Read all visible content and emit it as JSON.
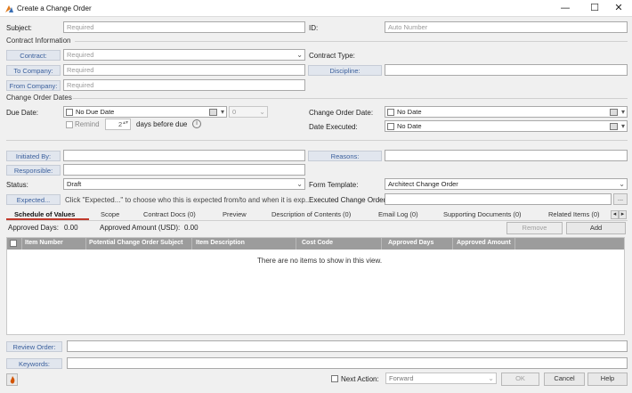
{
  "window": {
    "title": "Create a Change Order",
    "minimize": "—",
    "maximize": "☐",
    "close": "✕"
  },
  "form": {
    "subject_label": "Subject:",
    "subject_placeholder": "Required",
    "id_label": "ID:",
    "id_placeholder": "Auto Number",
    "contract_info_section": "Contract Information",
    "contract_btn": "Contract:",
    "contract_placeholder": "Required",
    "contract_type_label": "Contract Type:",
    "to_company_btn": "To Company:",
    "to_company_placeholder": "Required",
    "discipline_btn": "Discipline:",
    "from_company_btn": "From Company:",
    "from_company_placeholder": "Required",
    "dates_section": "Change Order Dates",
    "due_date_label": "Due Date:",
    "due_date_value": "No Due Date",
    "time_value": "0",
    "remind_label": "Remind",
    "remind_days": "2",
    "days_before_due": "days before due",
    "info_icon": "i",
    "co_date_label": "Change Order Date:",
    "co_date_value": "No Date",
    "executed_label": "Date Executed:",
    "executed_value": "No Date",
    "initiated_by_btn": "Initiated By:",
    "reasons_btn": "Reasons:",
    "responsible_btn": "Responsible:",
    "status_label": "Status:",
    "status_value": "Draft",
    "form_template_label": "Form Template:",
    "form_template_value": "Architect Change Order",
    "expected_btn": "Expected...",
    "expected_hint": "Click \"Expected...\" to choose who this is expected from/to and when it is exp...",
    "executed_co_label": "Executed Change Order:",
    "executed_co_browse": "...",
    "review_order_btn": "Review Order:",
    "keywords_btn": "Keywords:"
  },
  "tabs": [
    {
      "label": "Schedule of Values",
      "active": true
    },
    {
      "label": "Scope"
    },
    {
      "label": "Contract Docs (0)"
    },
    {
      "label": "Preview"
    },
    {
      "label": "Description of Contents (0)"
    },
    {
      "label": "Email Log (0)"
    },
    {
      "label": "Supporting Documents (0)"
    },
    {
      "label": "Related Items (0)"
    }
  ],
  "tab_scroll": {
    "left": "◂",
    "right": "▸"
  },
  "sov": {
    "approved_days_label": "Approved Days:",
    "approved_days_value": "0.00",
    "approved_amount_label": "Approved Amount (USD):",
    "approved_amount_value": "0.00",
    "remove_btn": "Remove",
    "add_btn": "Add",
    "columns": [
      "Item Number",
      "Potential Change Order Subject",
      "Item Description",
      "Cost Code",
      "Approved Days",
      "Approved Amount"
    ],
    "empty_message": "There are no items to show in this view."
  },
  "footer": {
    "next_action_label": "Next Action:",
    "next_action_value": "Forward",
    "ok_btn": "OK",
    "cancel_btn": "Cancel",
    "help_btn": "Help"
  },
  "colors": {
    "accent": "#3a5f9c",
    "tab_underline": "#c0392b",
    "grid_header": "#9c9c9c"
  }
}
